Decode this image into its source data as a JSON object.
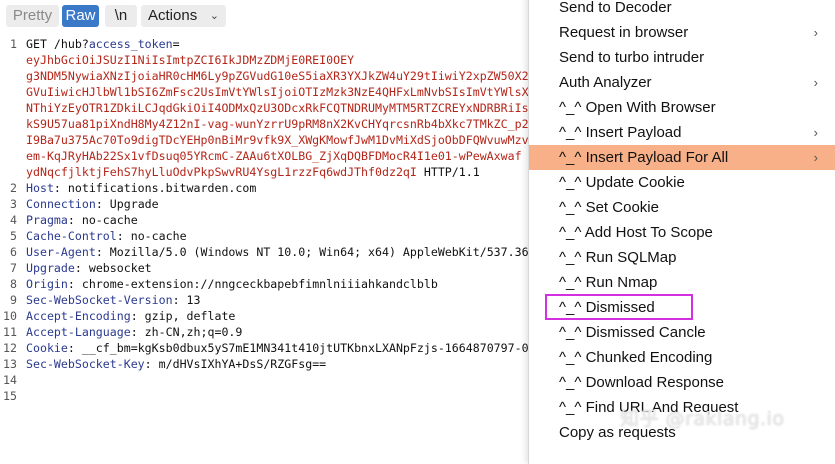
{
  "toolbar": {
    "pretty": "Pretty",
    "raw": "Raw",
    "newline": "\\n",
    "actions": "Actions",
    "actions_chevron": "⌄"
  },
  "request": {
    "lines": [
      {
        "n": "1",
        "parts": [
          {
            "t": "GET /hub?",
            "c": ""
          },
          {
            "t": "access_token",
            "c": "param"
          },
          {
            "t": "=",
            "c": ""
          }
        ]
      },
      {
        "n": "",
        "parts": [
          {
            "t": "eyJhbGciOiJSUzI1NiIsImtpZCI6IkJDMzZDMjE0REI0OEY",
            "c": "tok"
          }
        ]
      },
      {
        "n": "",
        "parts": [
          {
            "t": "g3NDM5NywiaXNzIjoiaHR0cHM6Ly9pZGVudG10eS5iaXR3YXJkZW4uY29tIiwiY2xpZW50X2",
            "c": "tok"
          }
        ]
      },
      {
        "n": "",
        "parts": [
          {
            "t": "GVuIiwicHJlbWl1bSI6ZmFsc2UsImVtYWlsIjoiOTIzMzk3NzE4QHFxLmNvbSIsImVtYWlsX",
            "c": "tok"
          }
        ]
      },
      {
        "n": "",
        "parts": [
          {
            "t": "NThiYzEyOTR1ZDkiLCJqdGkiOiI4ODMxQzU3ODcxRkFCQTNDRUMyMTM5RTZCREYxNDRBRiIs",
            "c": "tok"
          }
        ]
      },
      {
        "n": "",
        "parts": [
          {
            "t": "kS9U57ua81piXndH8My4Z12nI-vag-wunYzrrU9pRM8nX2KvCHYqrcsnRb4bXkc7TMkZC_p2",
            "c": "tok"
          }
        ]
      },
      {
        "n": "",
        "parts": [
          {
            "t": "I9Ba7u375Ac70To9digTDcYEHp0nBiMr9vfk9X_XWgKMowfJwM1DvMiXdSjoObDFQWvuwMzv",
            "c": "tok"
          }
        ]
      },
      {
        "n": "",
        "parts": [
          {
            "t": "em-KqJRyHAb22Sx1vfDsuq05YRcmC-ZAAu6tXOLBG_ZjXqDQBFDMocR4I1e01-wPewAxwaf",
            "c": "tok"
          }
        ]
      },
      {
        "n": "",
        "parts": [
          {
            "t": "ydNqcfjlktjFehS7hyLluOdvPkpSwvRU4YsgL1rzzFq6wdJThf0dz2qI",
            "c": "tok"
          },
          {
            "t": " HTTP/1.1",
            "c": ""
          }
        ]
      },
      {
        "n": "2",
        "parts": [
          {
            "t": "Host",
            "c": "key"
          },
          {
            "t": ": notifications.bitwarden.com",
            "c": ""
          }
        ]
      },
      {
        "n": "3",
        "parts": [
          {
            "t": "Connection",
            "c": "key"
          },
          {
            "t": ": Upgrade",
            "c": ""
          }
        ]
      },
      {
        "n": "4",
        "parts": [
          {
            "t": "Pragma",
            "c": "key"
          },
          {
            "t": ": no-cache",
            "c": ""
          }
        ]
      },
      {
        "n": "5",
        "parts": [
          {
            "t": "Cache-Control",
            "c": "key"
          },
          {
            "t": ": no-cache",
            "c": ""
          }
        ]
      },
      {
        "n": "6",
        "parts": [
          {
            "t": "User-Agent",
            "c": "key"
          },
          {
            "t": ": Mozilla/5.0 (Windows NT 10.0; Win64; x64) AppleWebKit/537.36",
            "c": ""
          }
        ]
      },
      {
        "n": "7",
        "parts": [
          {
            "t": "Upgrade",
            "c": "key"
          },
          {
            "t": ": websocket",
            "c": ""
          }
        ]
      },
      {
        "n": "8",
        "parts": [
          {
            "t": "Origin",
            "c": "key"
          },
          {
            "t": ": chrome-extension://nngceckbapebfimnlniiiahkandclblb",
            "c": ""
          }
        ]
      },
      {
        "n": "9",
        "parts": [
          {
            "t": "Sec-WebSocket-Version",
            "c": "key"
          },
          {
            "t": ": 13",
            "c": ""
          }
        ]
      },
      {
        "n": "10",
        "parts": [
          {
            "t": "Accept-Encoding",
            "c": "key"
          },
          {
            "t": ": gzip, deflate",
            "c": ""
          }
        ]
      },
      {
        "n": "11",
        "parts": [
          {
            "t": "Accept-Language",
            "c": "key"
          },
          {
            "t": ": zh-CN,zh;q=0.9",
            "c": ""
          }
        ]
      },
      {
        "n": "12",
        "parts": [
          {
            "t": "Cookie",
            "c": "key"
          },
          {
            "t": ": __cf_bm=kgKsb0dbux5yS7mE1MN341t410jtUTKbnxLXANpFzjs-1664870797-0",
            "c": ""
          }
        ]
      },
      {
        "n": "13",
        "parts": [
          {
            "t": "Sec-WebSocket-Key",
            "c": "key"
          },
          {
            "t": ": m/dHVsIXhYA+DsS/RZGFsg==",
            "c": ""
          }
        ]
      },
      {
        "n": "14",
        "parts": []
      },
      {
        "n": "15",
        "parts": []
      }
    ]
  },
  "context_menu": {
    "items": [
      {
        "label": "Send to Decoder",
        "submenu": false,
        "indent": 0,
        "highlighted": false
      },
      {
        "label": "Request in browser",
        "submenu": true,
        "indent": 0,
        "highlighted": false
      },
      {
        "label": "Send to turbo intruder",
        "submenu": false,
        "indent": 0,
        "highlighted": false
      },
      {
        "label": "Auth Analyzer",
        "submenu": true,
        "indent": 0,
        "highlighted": false
      },
      {
        "label": "^_^ Open With Browser",
        "submenu": false,
        "indent": 0,
        "highlighted": false
      },
      {
        "label": "^_^ Insert Payload",
        "submenu": true,
        "indent": 0,
        "highlighted": false
      },
      {
        "label": "^_^ Insert Payload For All",
        "submenu": true,
        "indent": 0,
        "highlighted": true
      },
      {
        "label": "^_^ Update Cookie",
        "submenu": false,
        "indent": 0,
        "highlighted": false
      },
      {
        "label": "^_^ Set Cookie",
        "submenu": false,
        "indent": 0,
        "highlighted": false
      },
      {
        "label": "^_^ Add Host To Scope",
        "submenu": false,
        "indent": 0,
        "highlighted": false
      },
      {
        "label": "^_^ Run SQLMap",
        "submenu": false,
        "indent": 0,
        "highlighted": false
      },
      {
        "label": "^_^ Run Nmap",
        "submenu": false,
        "indent": 0,
        "highlighted": false
      },
      {
        "label": "^_^ Dismissed",
        "submenu": false,
        "indent": 0,
        "highlighted": false
      },
      {
        "label": "^_^ Dismissed Cancle",
        "submenu": false,
        "indent": 0,
        "highlighted": false
      },
      {
        "label": "^_^ Chunked Encoding",
        "submenu": false,
        "indent": 0,
        "highlighted": false
      },
      {
        "label": "^_^ Download Response",
        "submenu": false,
        "indent": 0,
        "highlighted": false
      },
      {
        "label": "^_^ Find URL And Request",
        "submenu": false,
        "indent": 0,
        "highlighted": false
      },
      {
        "label": "Copy as requests",
        "submenu": false,
        "indent": 0,
        "highlighted": false
      }
    ],
    "highlight_color": "#f7b088",
    "annotation_color": "#d42fe0"
  },
  "watermark": "知乎 @raklang.io",
  "colors": {
    "raw_active": "#3a78c8",
    "token": "#b5261a",
    "header_key": "#2b3a8f"
  }
}
